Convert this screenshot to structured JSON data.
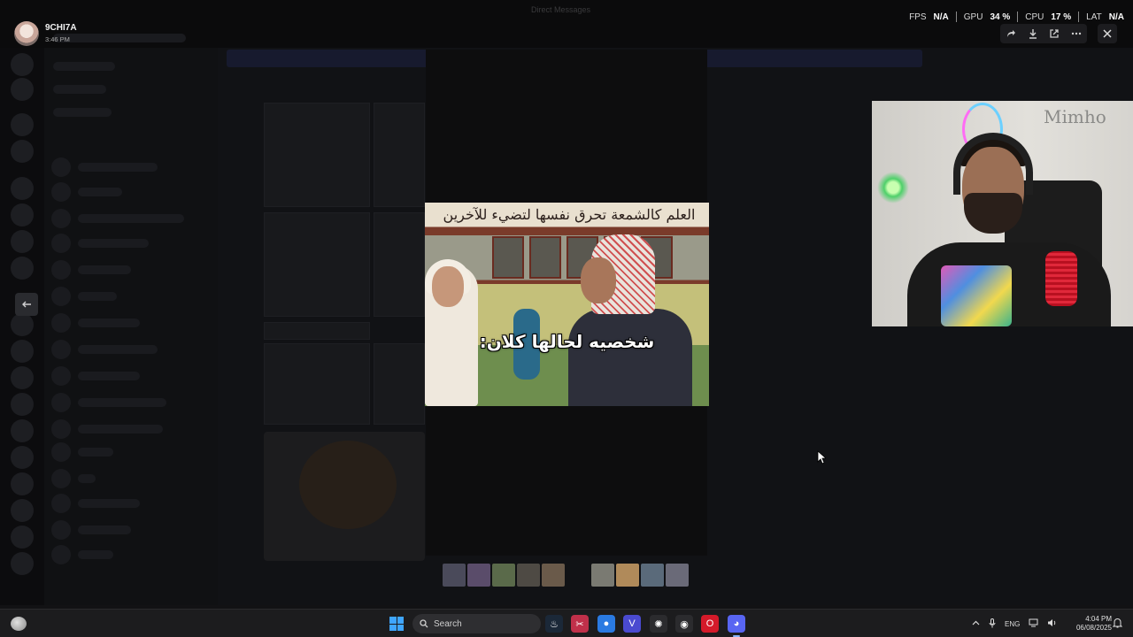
{
  "user": {
    "name": "9CHI7A",
    "time": "3:46 PM"
  },
  "top_center_label": "Direct Messages",
  "perf": [
    {
      "key": "FPS",
      "value": "N/A"
    },
    {
      "key": "GPU",
      "value": "34 %"
    },
    {
      "key": "CPU",
      "value": "17 %"
    },
    {
      "key": "LAT",
      "value": "N/A"
    }
  ],
  "media_viewer": {
    "actions": [
      "forward-icon",
      "download-icon",
      "open-external-icon",
      "more-icon"
    ],
    "close_icon": "close-icon",
    "back_icon": "arrow-left-icon",
    "video_banner_text": "العلم كالشمعة تحرق نفسها لتضيء للآخرين",
    "video_subtitle": "شخصيه لحالها كلان:"
  },
  "webcam": {
    "logo_text": "Mimho"
  },
  "thumbnails": [
    {
      "color": "#4a4a5a"
    },
    {
      "color": "#5a4c6a"
    },
    {
      "color": "#5a6a4a"
    },
    {
      "color": "#4e4a44"
    },
    {
      "color": "#6a5a4a"
    },
    {
      "color": "#7a7a72"
    },
    {
      "color": "#b08a5a"
    },
    {
      "color": "#5a6a7a"
    },
    {
      "color": "#6a6a78"
    }
  ],
  "taskbar": {
    "search_placeholder": "Search",
    "apps": [
      {
        "name": "steam-icon",
        "glyph": "♨",
        "bg": "#1b2838"
      },
      {
        "name": "snipping-tool-icon",
        "glyph": "✂",
        "bg": "#c0304a"
      },
      {
        "name": "chrome-icon",
        "glyph": "●",
        "bg": "#2a7ae2"
      },
      {
        "name": "vivaldi-icon",
        "glyph": "V",
        "bg": "#4a4ad0"
      },
      {
        "name": "chatgpt-icon",
        "glyph": "✺",
        "bg": "#2b2b2e"
      },
      {
        "name": "github-icon",
        "glyph": "◉",
        "bg": "#2b2b2e"
      },
      {
        "name": "opera-icon",
        "glyph": "O",
        "bg": "#d41a2a"
      },
      {
        "name": "discord-icon",
        "glyph": "◕",
        "bg": "#5865f2"
      }
    ],
    "tray": {
      "language": "ENG"
    },
    "clock": {
      "time": "4:04 PM",
      "date": "06/08/2025"
    }
  }
}
